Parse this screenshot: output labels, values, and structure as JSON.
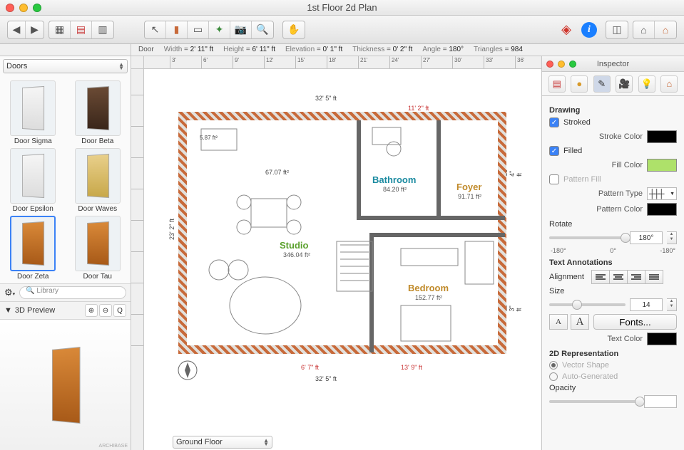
{
  "window": {
    "title": "1st Floor 2d Plan"
  },
  "status": {
    "object": "Door",
    "metrics": [
      {
        "label": "Width",
        "value": "2' 11\" ft"
      },
      {
        "label": "Height",
        "value": "6' 11\" ft"
      },
      {
        "label": "Elevation",
        "value": "0' 1\" ft"
      },
      {
        "label": "Thickness",
        "value": "0' 2\" ft"
      },
      {
        "label": "Angle",
        "value": "180°"
      },
      {
        "label": "Triangles",
        "value": "984"
      }
    ]
  },
  "library": {
    "category": "Doors",
    "items": [
      {
        "name": "Door Sigma"
      },
      {
        "name": "Door Beta"
      },
      {
        "name": "Door Epsilon"
      },
      {
        "name": "Door Waves"
      },
      {
        "name": "Door Zeta",
        "selected": true
      },
      {
        "name": "Door Tau"
      }
    ],
    "search_placeholder": "Library",
    "preview_label": "3D Preview"
  },
  "canvas": {
    "ruler_ticks": [
      "3'",
      "6'",
      "9'",
      "12'",
      "15'",
      "18'",
      "21'",
      "24'",
      "27'",
      "30'",
      "33'",
      "36'"
    ],
    "floor_selector": "Ground Floor",
    "outer_dims": {
      "top": "32' 5\" ft",
      "bottom": "32' 5\" ft",
      "left": "23' 2\" ft",
      "right_upper": "10' 4\" ft",
      "right_lower": "11' 3\" ft"
    },
    "red_dims": {
      "top": "11' 2\" ft",
      "bottom_left": "6' 7\" ft",
      "bottom_right": "13' 9\" ft",
      "tiny": "5.87 ft²"
    },
    "rooms": [
      {
        "name": "Studio",
        "area": "346.04 ft²",
        "color": "#5aa02c"
      },
      {
        "name": "Bathroom",
        "area": "84.20 ft²",
        "color": "#1a8aa0"
      },
      {
        "name": "Foyer",
        "area": "91.71 ft²",
        "color": "#c08a2a"
      },
      {
        "name": "Bedroom",
        "area": "152.77 ft²",
        "color": "#c08a2a"
      }
    ],
    "hall_area": "67.07 ft²"
  },
  "inspector": {
    "title": "Inspector",
    "drawing_header": "Drawing",
    "stroked_label": "Stroked",
    "stroke_color_label": "Stroke Color",
    "filled_label": "Filled",
    "fill_color_label": "Fill Color",
    "pattern_fill_label": "Pattern Fill",
    "pattern_type_label": "Pattern Type",
    "pattern_color_label": "Pattern Color",
    "rotate_label": "Rotate",
    "rotate_value": "180°",
    "rotate_ticks": [
      "-180°",
      "0°",
      "-180°"
    ],
    "text_ann_header": "Text Annotations",
    "alignment_label": "Alignment",
    "size_label": "Size",
    "size_value": "14",
    "fonts_btn": "Fonts...",
    "text_color_label": "Text Color",
    "rep_header": "2D Representation",
    "vector_label": "Vector Shape",
    "auto_label": "Auto-Generated",
    "opacity_label": "Opacity",
    "stroked_checked": true,
    "filled_checked": true,
    "pattern_fill_checked": false,
    "colors": {
      "stroke": "#000000",
      "fill": "#aee16a",
      "pattern": "#000000",
      "text": "#000000"
    }
  }
}
